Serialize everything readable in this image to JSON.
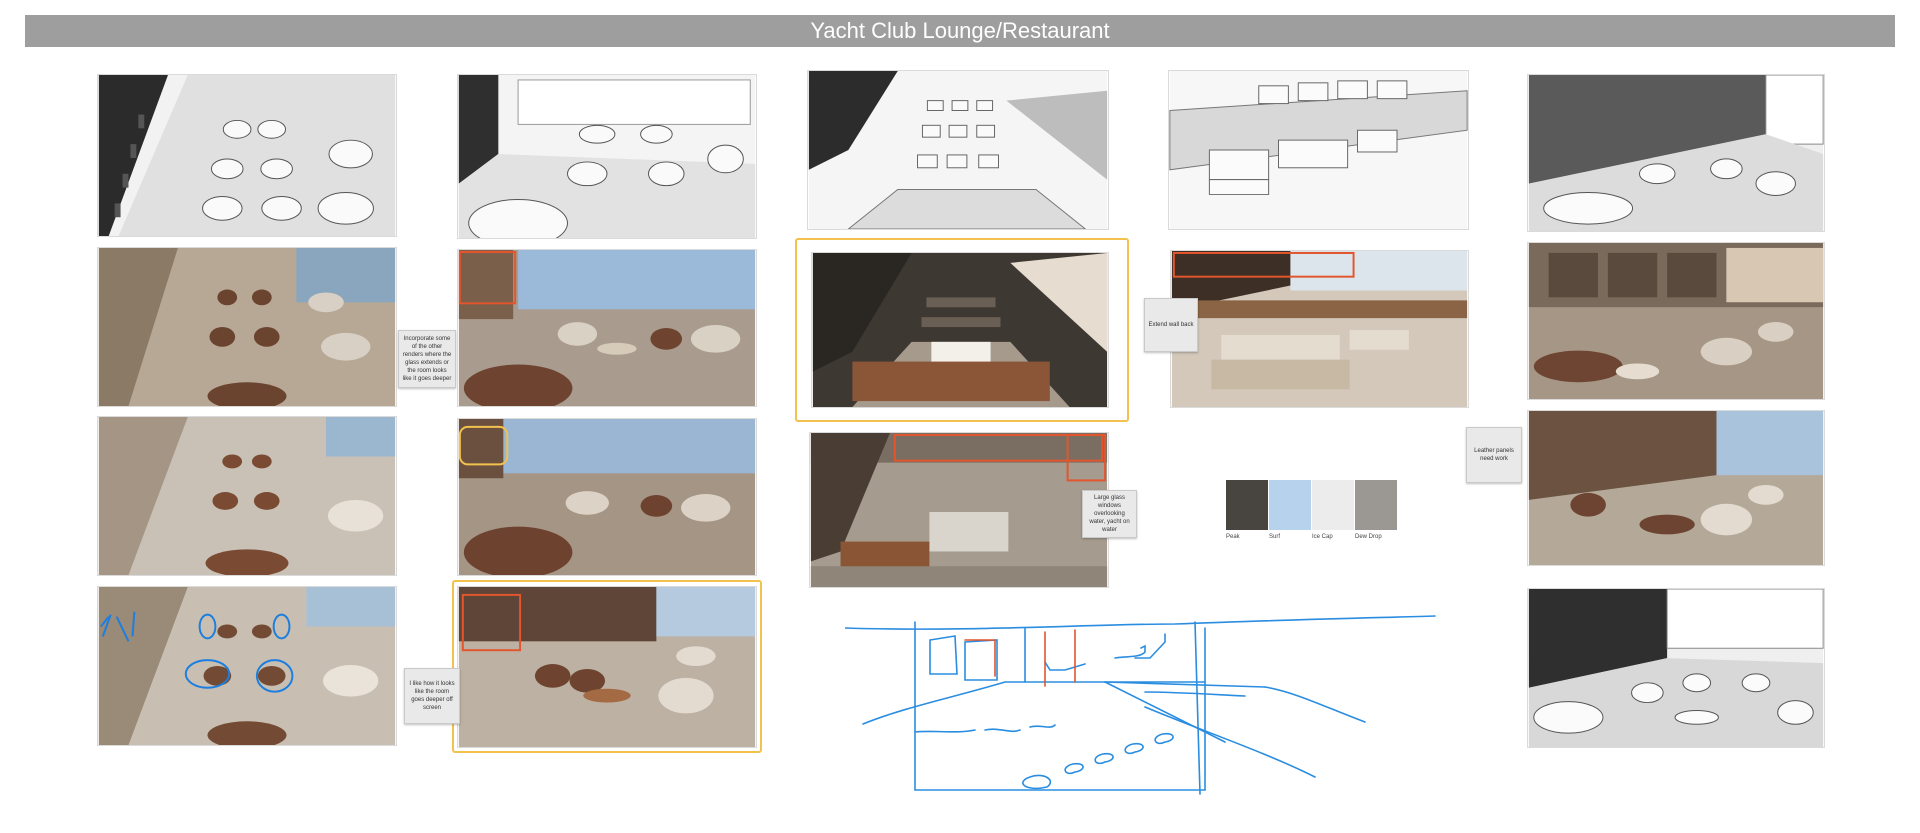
{
  "header": {
    "title": "Yacht Club Lounge/Restaurant"
  },
  "notes": {
    "incorporate": "Incorporate some of the other renders where the glass extends or the room looks like it goes deeper",
    "like_how": "I like how it looks like the room goes deeper off screen",
    "large_glass": "Large glass windows overlooking water, yacht on water",
    "extend_wall": "Extend wall back",
    "leather_panels": "Leather panels need work"
  },
  "palette": [
    {
      "name": "Peak",
      "color": "#48443f"
    },
    {
      "name": "Surf",
      "color": "#b7d2ec"
    },
    {
      "name": "Ice Cap",
      "color": "#ececec"
    },
    {
      "name": "Dew Drop",
      "color": "#9b9793"
    }
  ],
  "colors": {
    "title_bar": "#9e9e9e",
    "highlight_yellow": "#f2c14e",
    "markup_red": "#e2552d",
    "sketch_blue": "#2a8de0"
  }
}
